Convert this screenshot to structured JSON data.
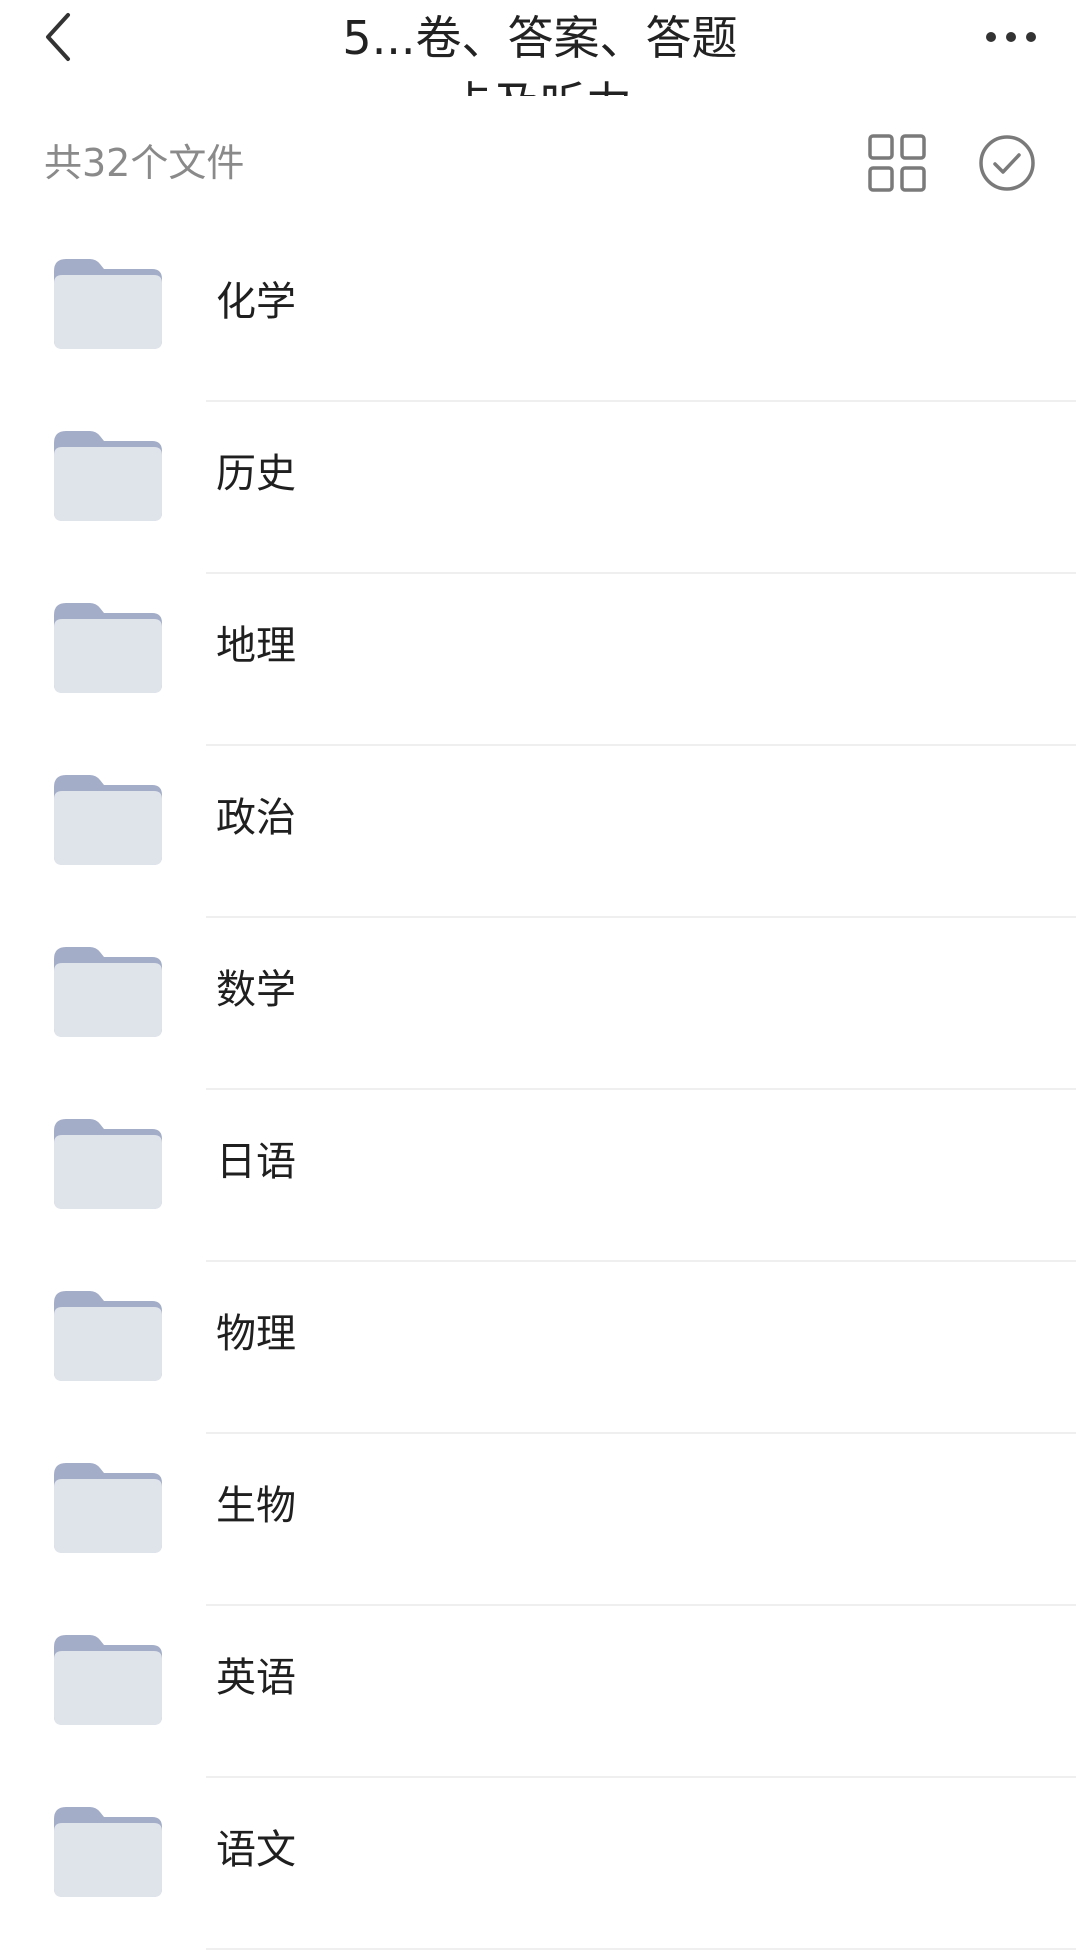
{
  "header": {
    "title_line1": "5...卷、答案、答题",
    "title_line2": "卡及听力"
  },
  "summary": {
    "file_count": "共32个文件"
  },
  "folders": [
    {
      "name": "化学"
    },
    {
      "name": "历史"
    },
    {
      "name": "地理"
    },
    {
      "name": "政治"
    },
    {
      "name": "数学"
    },
    {
      "name": "日语"
    },
    {
      "name": "物理"
    },
    {
      "name": "生物"
    },
    {
      "name": "英语"
    },
    {
      "name": "语文"
    }
  ],
  "colors": {
    "folder_back": "#a3adc7",
    "folder_front": "#dfe3ea",
    "icon_gray": "#7a7a7a",
    "divider": "#efefef"
  }
}
